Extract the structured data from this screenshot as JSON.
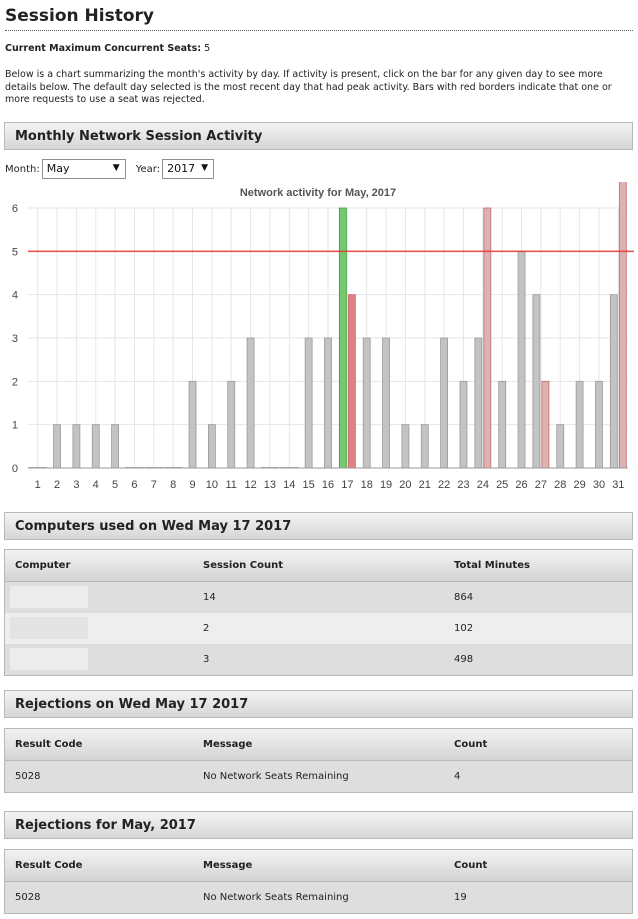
{
  "page": {
    "title": "Session History",
    "seats_label": "Current Maximum Concurrent Seats:",
    "seats_value": "5",
    "intro": "Below is a chart summarizing the month's activity by day. If activity is present, click on the bar for any given day to see more details below. The default day selected is the most recent day that had peak activity. Bars with red borders indicate that one or more requests to use a seat was rejected."
  },
  "activity": {
    "header": "Monthly Network Session Activity",
    "month_label": "Month:",
    "month_value": "May",
    "year_label": "Year:",
    "year_value": "2017"
  },
  "chart_data": {
    "type": "bar",
    "title": "Network activity for May, 2017",
    "categories": [
      "1",
      "2",
      "3",
      "4",
      "5",
      "6",
      "7",
      "8",
      "9",
      "10",
      "11",
      "12",
      "13",
      "14",
      "15",
      "16",
      "17",
      "18",
      "19",
      "20",
      "21",
      "22",
      "23",
      "24",
      "25",
      "26",
      "27",
      "28",
      "29",
      "30",
      "31"
    ],
    "values": [
      0,
      1,
      1,
      1,
      1,
      0,
      0,
      0,
      2,
      1,
      2,
      3,
      0,
      0,
      3,
      3,
      6,
      3,
      3,
      1,
      1,
      3,
      2,
      3,
      2,
      5,
      4,
      1,
      2,
      2,
      4
    ],
    "rejections": [
      0,
      0,
      0,
      0,
      0,
      0,
      0,
      0,
      0,
      0,
      0,
      0,
      0,
      0,
      0,
      0,
      4,
      0,
      0,
      0,
      0,
      0,
      0,
      6,
      0,
      0,
      2,
      0,
      0,
      0,
      7
    ],
    "selected_day": "17",
    "ylim": [
      0,
      6
    ],
    "yticks": [
      0,
      1,
      2,
      3,
      4,
      5,
      6
    ],
    "threshold": 5,
    "grid": true,
    "colors": {
      "bar": "#c3c3c3",
      "bar_border": "#9a9a9a",
      "selected": "#74c96e",
      "selected_border": "#3f9a3a",
      "rejection": "#e08083",
      "rejection_faded": "#dcb2b2",
      "threshold": "#e63a3a",
      "grid": "#e6e6e6"
    }
  },
  "computers": {
    "header": "Computers used on Wed May 17 2017",
    "columns": [
      "Computer",
      "Session Count",
      "Total Minutes"
    ],
    "rows": [
      {
        "session_count": "14",
        "total_minutes": "864"
      },
      {
        "session_count": "2",
        "total_minutes": "102"
      },
      {
        "session_count": "3",
        "total_minutes": "498"
      }
    ]
  },
  "rejections_day": {
    "header": "Rejections on Wed May 17 2017",
    "columns": [
      "Result Code",
      "Message",
      "Count"
    ],
    "rows": [
      {
        "code": "5028",
        "message": "No Network Seats Remaining",
        "count": "4"
      }
    ]
  },
  "rejections_month": {
    "header": "Rejections for May, 2017",
    "columns": [
      "Result Code",
      "Message",
      "Count"
    ],
    "rows": [
      {
        "code": "5028",
        "message": "No Network Seats Remaining",
        "count": "19"
      }
    ]
  }
}
